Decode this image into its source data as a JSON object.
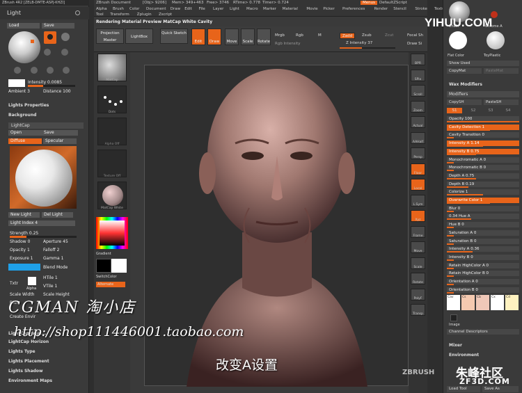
{
  "left_panel": {
    "app_title": "ZBrush 4R2 [ZELB-DMTE-ASPJ-KHZI]",
    "panel_title": "Light",
    "load": "Load",
    "save": "Save",
    "intensity": "Intensity 0.0085",
    "ambient": "Ambient 3",
    "distance": "Distance 100",
    "light_properties": "Lights Properties",
    "background": "Background",
    "lightcap": "LightCap",
    "open": "Open",
    "save2": "Save",
    "diffuse": "Diffuse",
    "specular": "Specular",
    "new_light": "New Light",
    "del_light": "Del Light",
    "light_index": "Light Index 4",
    "strength": "Strength 0.25",
    "shadow": "Shadow 0",
    "aperture": "Aperture 45",
    "opacity": "Opacity 1",
    "falloff": "Falloff 2",
    "exposure": "Exposure 1",
    "gamma": "Gamma 1",
    "blend_mode": "Blend Mode",
    "txtr": "Txtr",
    "alpha": "Alpha",
    "htile": "HTile 1",
    "vtile": "VTile 1",
    "scale_width": "Scale Width",
    "scale_height": "Scale Height",
    "blur": "Blur",
    "create_env": "Create Envir",
    "lightcap_adjust": "LightCap Adju...",
    "lightcap_horizon": "LightCap Horizon",
    "lights_type": "Lights Type",
    "lights_placement": "Lights Placement",
    "lights_shadow": "Lights Shadow",
    "env_maps": "Environment Maps"
  },
  "top": {
    "doc_title": "ZBrush Document",
    "obj": "[Obj> 9206]",
    "mem": "Mem> 349+463",
    "free": "Free> 3746",
    "rtime": "RTime> 0.778",
    "timer": "Timer> 0.724",
    "menus_btn": "Menus",
    "default_script": "DefaultZScript",
    "menu_items": [
      "Alpha",
      "Brush",
      "Color",
      "Document",
      "Draw",
      "Edit",
      "File",
      "Layer",
      "Light",
      "Macro",
      "Marker",
      "Material",
      "Movie",
      "Picker",
      "Preferences",
      "Render",
      "Stencil",
      "Stroke",
      "Texture"
    ],
    "menu_items2": [
      "Tool",
      "Transform",
      "Zplugin",
      "Zscript"
    ],
    "status": "Rendering Material Preview MatCap White Cavity"
  },
  "toolbar": {
    "projection_master": "Projection Master",
    "lightbox": "LightBox",
    "quick_sketch": "Quick Sketch",
    "edit": "Edit",
    "draw": "Draw",
    "move": "Move",
    "scale": "Scale",
    "rotate": "Rotate",
    "mrgb": "Mrgb",
    "rgb": "Rgb",
    "m": "M",
    "rgb_intensity": "Rgb Intensity",
    "zadd": "Zadd",
    "zsub": "Zsub",
    "zcut": "Zcut",
    "z_intensity": "Z Intensity 37",
    "focal_shift": "Focal Sh",
    "draw_size": "Draw Si"
  },
  "shelf": {
    "mtl1": "MatCap",
    "mtl2": "Dots",
    "mtl3": "Alpha Off",
    "mtl4": "Texture Off",
    "mtl5": "MatCap White",
    "gradient": "Gradient",
    "switch_color": "SwitchColor",
    "alternate": "Alternate"
  },
  "right_shelf": [
    "BPR",
    "SPix",
    "Scroll",
    "Zoom",
    "Actual",
    "AAHalf",
    "Persp",
    "Floor",
    "Local",
    "L.Sym",
    "Xyz",
    "Frame",
    "Move",
    "Scale",
    "Rotate",
    "PolyF",
    "Transp"
  ],
  "right_panel": {
    "chalk": "Chalk",
    "chrome_a": "Chrome A",
    "flat_color": "Flat Color",
    "toy_plastic": "ToyPlastic",
    "show_used": "Show Used",
    "copy_mat": "CopyMat",
    "paste_mat": "PasteMat",
    "wax_modifiers": "Wax Modifiers",
    "modifiers": "Modifiers",
    "copy_sh": "CopySH",
    "paste_sh": "PasteSH",
    "s1": "S1",
    "s2": "S2",
    "s3": "S3",
    "s4": "S4",
    "rows": [
      "Opacity 100",
      "Cavity Detection 1",
      "Cavity Transition 0",
      "Intensity A 1.14",
      "Intensity B 0.75",
      "Monochromatic A 0",
      "Monochromatic B 0",
      "Depth A 0.75",
      "Depth B 0.19",
      "Colorize 1",
      "Overwrite Color 1",
      "Blur 0",
      "0.34 Hue A",
      "Hue B 0",
      "Saturation A 0",
      "Saturation B 0",
      "Intensity A 0.36",
      "Intensity B 0",
      "Retain HighColor A 0",
      "Retain HighColor B 0",
      "Orientation A 0",
      "Orientation B 0"
    ],
    "swatches": [
      "Cav",
      "Cs",
      "Cb",
      "Cx",
      "Cd"
    ],
    "image": "Image",
    "channel_desc": "Channel Descriptors",
    "mixer": "Mixer",
    "environment": "Environment",
    "load_tool": "Load Tool",
    "save_as": "Save As"
  },
  "watermarks": {
    "top_logo": "YIHUU.COM",
    "cgman": "CGMAN 淘小店",
    "url": "http://shop111446001.taobao.com",
    "subtitle": "改变A设置",
    "zbrush_logo": "ZBRUSH",
    "zf3d_cn": "朱峰社区",
    "zf3d_en": "ZF3D.COM"
  }
}
